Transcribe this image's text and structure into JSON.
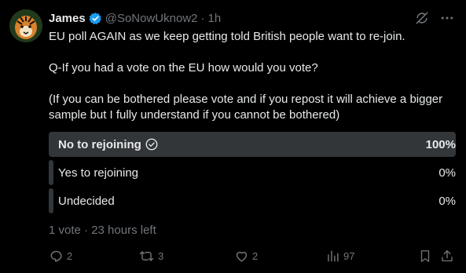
{
  "tweet": {
    "author_name": "James",
    "handle": "@SoNowUknow2",
    "separator": "·",
    "time": "1h",
    "paragraphs": [
      "EU poll AGAIN as we keep getting told British people want to re-join.",
      "Q-If you had a vote on the EU how would you vote?",
      "(If you can be bothered please vote and if you repost it will achieve a bigger sample but I fully understand if you cannot be bothered)"
    ]
  },
  "poll": {
    "options": [
      {
        "label": "No to rejoining",
        "percent_text": "100%",
        "fraction": 1.0,
        "winner": true
      },
      {
        "label": "Yes to rejoining",
        "percent_text": "0%",
        "fraction": 0.0,
        "winner": false
      },
      {
        "label": "Undecided",
        "percent_text": "0%",
        "fraction": 0.0,
        "winner": false
      }
    ],
    "meta": "1 vote · 23 hours left"
  },
  "actions": {
    "replies": "2",
    "reposts": "3",
    "likes": "2",
    "views": "97"
  },
  "colors": {
    "background": "#000000",
    "text": "#e7e9ea",
    "muted": "#71767b",
    "poll_bar": "#333639",
    "verified": "#1d9bf0"
  },
  "icons": {
    "verified": "verified-badge-icon",
    "grok": "grok-icon",
    "more": "more-icon",
    "check": "check-circle-icon",
    "reply": "reply-icon",
    "repost": "repost-icon",
    "like": "heart-icon",
    "views": "views-icon",
    "bookmark": "bookmark-icon",
    "share": "share-icon"
  }
}
